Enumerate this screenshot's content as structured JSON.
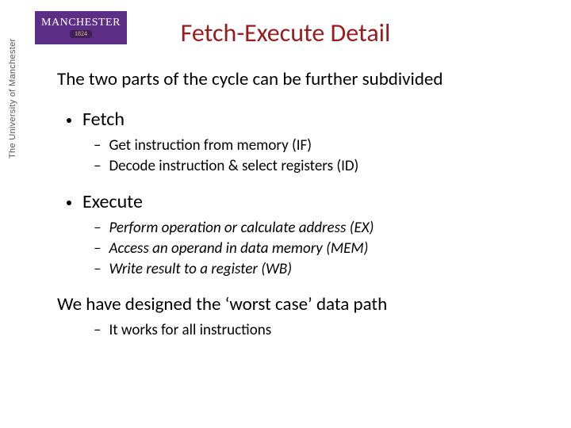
{
  "logo": {
    "top": "MANCHESTER",
    "bottom": "1824",
    "vertical": "The University of Manchester"
  },
  "title": "Fetch-Execute Detail",
  "lead": "The two parts of the cycle can be further subdivided",
  "bullets": [
    {
      "label": "Fetch",
      "italic": false,
      "items": [
        "Get instruction from memory (IF)",
        "Decode instruction & select registers (ID)"
      ]
    },
    {
      "label": "Execute",
      "italic": true,
      "items": [
        "Perform operation or calculate address (EX)",
        "Access an operand in data memory (MEM)",
        "Write result to a register (WB)"
      ]
    }
  ],
  "closing": "We have designed the ‘worst case’ data path",
  "closing_sub": "It works for all instructions",
  "dash": "–"
}
